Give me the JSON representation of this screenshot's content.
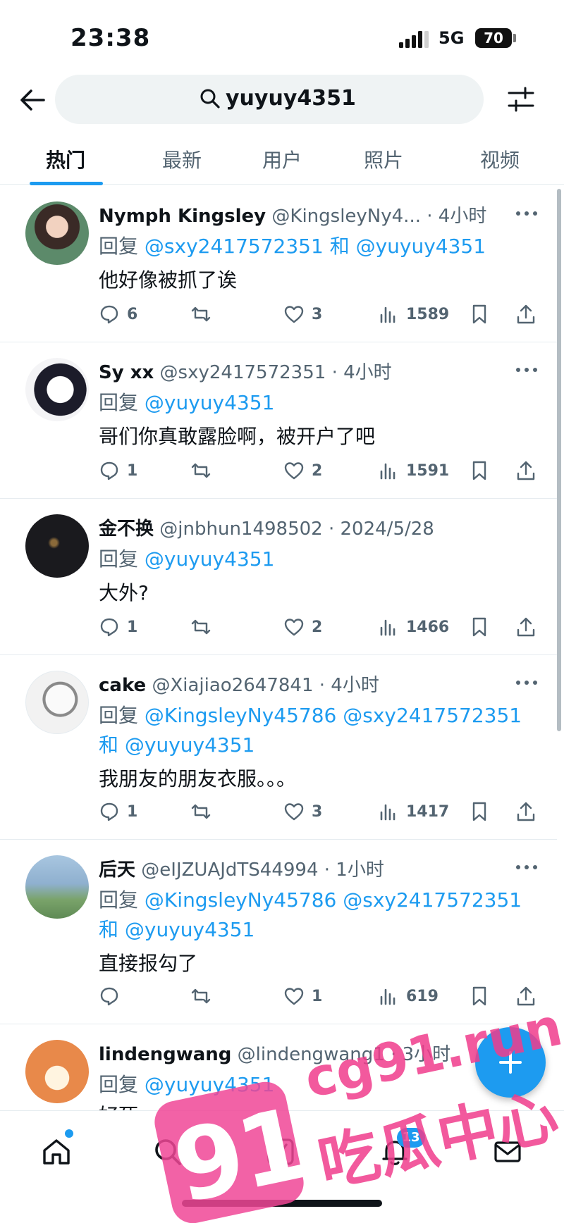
{
  "status_bar": {
    "time": "23:38",
    "network": "5G",
    "battery": "70"
  },
  "search": {
    "query": "yuyuy4351"
  },
  "tabs": [
    {
      "label": "热门"
    },
    {
      "label": "最新"
    },
    {
      "label": "用户"
    },
    {
      "label": "照片"
    },
    {
      "label": "视频"
    }
  ],
  "tweets": [
    {
      "name": "Nymph Kingsley",
      "handle": "@KingsleyNy4...",
      "time": "· 4小时",
      "reply_prefix": "回复",
      "reply_line1": "@sxy2417572351 和 @yuyuy4351",
      "reply_line2": "",
      "text": "他好像被抓了诶",
      "replies": "6",
      "retweets": "",
      "likes": "3",
      "views": "1589"
    },
    {
      "name": "Sy xx",
      "handle": "@sxy2417572351",
      "time": "· 4小时",
      "reply_prefix": "回复",
      "reply_line1": "@yuyuy4351",
      "reply_line2": "",
      "text": "哥们你真敢露脸啊，被开户了吧",
      "replies": "1",
      "retweets": "",
      "likes": "2",
      "views": "1591"
    },
    {
      "name": "金不换",
      "handle": "@jnbhun1498502",
      "time": "· 2024/5/28",
      "reply_prefix": "回复",
      "reply_line1": "@yuyuy4351",
      "reply_line2": "",
      "text": "大外?",
      "replies": "1",
      "retweets": "",
      "likes": "2",
      "views": "1466"
    },
    {
      "name": "cake",
      "handle": "@Xiajiao2647841",
      "time": "· 4小时",
      "reply_prefix": "回复",
      "reply_line1": "@KingsleyNy45786 @sxy2417572351",
      "reply_line2": "和 @yuyuy4351",
      "text": "我朋友的朋友衣服。。。",
      "replies": "1",
      "retweets": "",
      "likes": "3",
      "views": "1417"
    },
    {
      "name": "后天",
      "handle": "@eIJZUAJdTS44994",
      "time": "· 1小时",
      "reply_prefix": "回复",
      "reply_line1": "@KingsleyNy45786 @sxy2417572351",
      "reply_line2": "和 @yuyuy4351",
      "text": "直接报勾了",
      "replies": "",
      "retweets": "",
      "likes": "1",
      "views": "619"
    },
    {
      "name": "lindengwang",
      "handle": "@lindengwang1",
      "time": "· 3小时",
      "reply_prefix": "回复",
      "reply_line1": "@yuyuy4351",
      "reply_line2": "",
      "text": "好死",
      "replies": "",
      "retweets": "",
      "likes": "",
      "views": ""
    }
  ],
  "bottom_nav": {
    "notification_badge": "13"
  },
  "watermark": {
    "number": "91",
    "domain": "cg91.run",
    "text": "吃瓜中心"
  },
  "colors": {
    "accent": "#1d9bf0",
    "text": "#0f1419",
    "muted": "#536471",
    "watermark": "#f03c8c"
  }
}
